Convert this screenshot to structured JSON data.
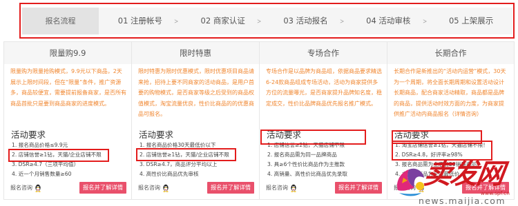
{
  "flow": {
    "title": "报名流程",
    "separator": ">",
    "steps": [
      "01 注册帐号",
      "02 商家认证",
      "03 活动报名",
      "04 活动审核",
      "05 上架展示"
    ]
  },
  "cards": [
    {
      "title": "限量购9.9",
      "description": "限量购为限量抢购模式，9.9元以下商品，2天展示上限时间段，但在“限量”条件，推广资源多，商品较便宜，需要提前报备商家，是否所有商品首批只是要到商品商家的进度模式。",
      "requirements_title": "活动要求",
      "requirements": [
        "1. 报名商品价格≤9.9元",
        "2. 店铺信誉≥1钻，天猫/企业店铺不限",
        "3. DSR≥4.7（三项平均值）",
        "4. 近一个月销售数量≥60"
      ],
      "consult_label": "报名咨询",
      "cta_label": "报名并了解详情"
    },
    {
      "title": "限时特惠",
      "description": "限时特惠为限时优惠模式，限时优惠项目商品请来抢，招待上要不同商家的活动商品，是用户首要的购物模式，是否商家等级之后受到的商品权值模式，淘宝流量优良，性价比商品的的优惠商品可报名。",
      "requirements_title": "活动要求",
      "requirements": [
        "1. 报名商品价格30天最低价以下",
        "2. 店铺信誉≥1钻，天猫/企业店铺不限",
        "3. DSR≥4.7，商品评分平均以上",
        "4. 高性价比商品优先审核"
      ],
      "consult_label": "报名咨询",
      "cta_label": "报名并了解详情"
    },
    {
      "title": "专场合作",
      "description": "专场合作是以品牌为商品组，依据商品要求精选6-24款商品组成专场活动，活动为商家提供多方位的流量曝光，是否商家提升品牌知名度，稳定成交，性价比品牌商品优先报名推广模式。",
      "requirements_title": "活动要求",
      "requirements": [
        "1. 店铺信誉≥2钻，天猫店铺不限",
        "2. 报名商品需为同一品牌商品",
        "3. 具≥6个性价比商品作为主推款",
        "4. 高销量、高性价比商品优先录取"
      ],
      "consult_label": "报名咨询",
      "cta_label": "报名并了解详情"
    },
    {
      "title": "长期合作",
      "description": "长期合作是新推出的“活动内运营”模式，30天为一个周期，将全面长期周期和设置活动设计长期商品，配合商家活动精取，商品都是品牌的商品，提供活动时效方面的力度，为商家提供推广活动内商品报名（详情咨询）",
      "requirements_title": "活动要求",
      "requirements": [
        "1. 淘宝店铺信誉≥1钻，天猫店铺不限！",
        "2. DSR≥4.8，好评率≥98%",
        "3. 报名商品需为全店前20销量商品",
        "4. 主推款商品为全店最低价"
      ],
      "consult_label": "报名咨询",
      "cta_label": "报名并了解详情"
    }
  ],
  "watermark": {
    "logo_text": "卖发网",
    "logo_url": "www.spf.cn",
    "site": "news.maijia.com"
  },
  "icons": {
    "step_separator": "chevron-right-icon",
    "consult": "qq-icon",
    "watermark": "watermark-logo-graphic"
  },
  "colors": {
    "accent": "#e9506b",
    "description": "#f0862f",
    "highlight": "#e31c1c",
    "watermark": "#d11920"
  }
}
